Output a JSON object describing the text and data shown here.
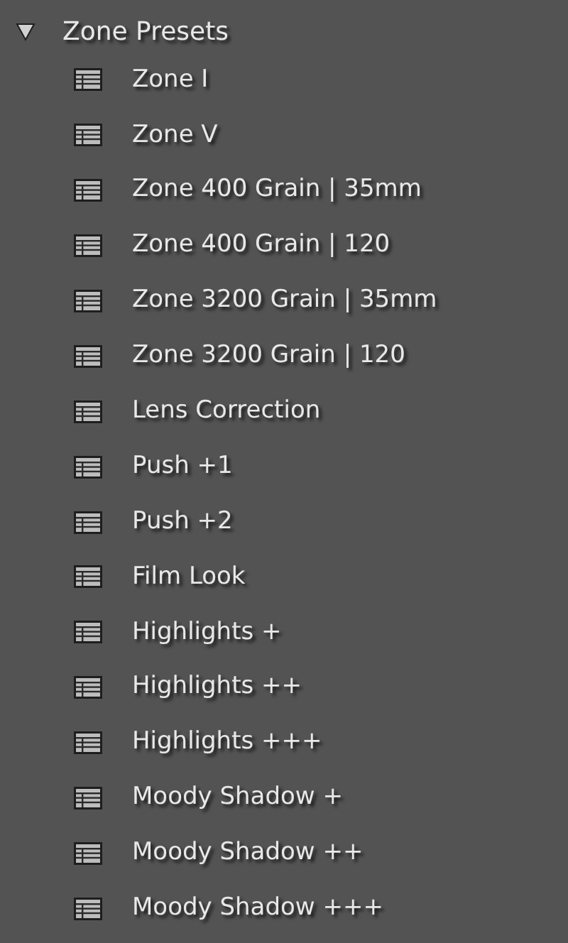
{
  "folder": {
    "title": "Zone Presets",
    "expanded": true
  },
  "presets": [
    {
      "name": "Zone I"
    },
    {
      "name": "Zone V"
    },
    {
      "name": "Zone 400 Grain | 35mm"
    },
    {
      "name": "Zone 400 Grain | 120"
    },
    {
      "name": "Zone 3200 Grain | 35mm"
    },
    {
      "name": "Zone 3200 Grain | 120"
    },
    {
      "name": "Lens Correction"
    },
    {
      "name": "Push +1"
    },
    {
      "name": "Push +2"
    },
    {
      "name": "Film Look"
    },
    {
      "name": "Highlights +"
    },
    {
      "name": "Highlights ++"
    },
    {
      "name": "Highlights +++"
    },
    {
      "name": "Moody Shadow +"
    },
    {
      "name": "Moody Shadow ++"
    },
    {
      "name": "Moody Shadow +++"
    }
  ]
}
